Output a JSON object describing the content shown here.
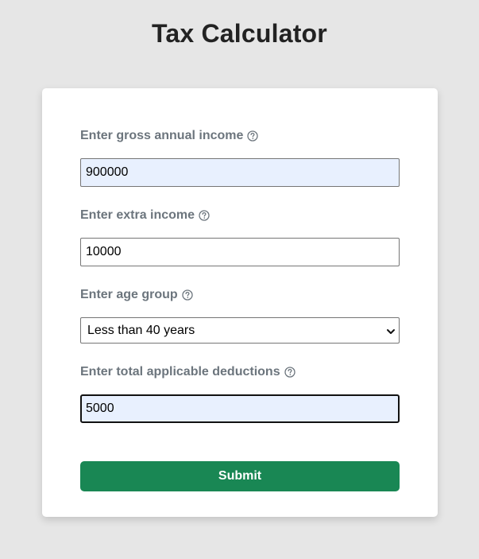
{
  "page": {
    "title": "Tax Calculator"
  },
  "form": {
    "gross_income": {
      "label": "Enter gross annual income",
      "value": "900000"
    },
    "extra_income": {
      "label": "Enter extra income",
      "value": "10000"
    },
    "age_group": {
      "label": "Enter age group",
      "selected": "Less than 40 years"
    },
    "deductions": {
      "label": "Enter total applicable deductions",
      "value": "5000"
    },
    "submit_label": "Submit"
  },
  "colors": {
    "background": "#e6e6e6",
    "card": "#ffffff",
    "label": "#6c757d",
    "autofill": "#e8f0fe",
    "submit": "#198754"
  },
  "icons": {
    "help": "question-circle-icon",
    "select": "chevron-down-icon"
  }
}
